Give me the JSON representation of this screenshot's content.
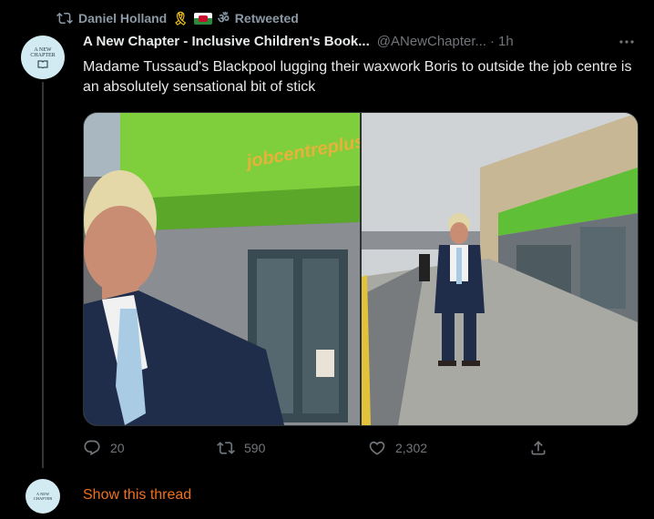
{
  "retweet": {
    "icon": "retweet-icon",
    "user_name": "Daniel Holland",
    "emoji_ribbon": "🎗",
    "flag_icon": "welsh-flag-icon",
    "emoji_om": "ॐ",
    "label": "Retweeted"
  },
  "tweet": {
    "avatar_text": "A NEW CHAPTER",
    "author_name": "A New Chapter - Inclusive Children's Book...",
    "handle": "@ANewChapter...",
    "separator": "·",
    "time": "1h",
    "more_icon": "more-icon",
    "text": "Madame Tussaud's Blackpool lugging their waxwork Boris to outside the job centre is an absolutely sensational bit of stick"
  },
  "media": {
    "images": [
      {
        "icon": "photo-waxwork-closeup-jobcentre"
      },
      {
        "icon": "photo-waxwork-street-jobcentre"
      }
    ],
    "sign_text": "jobcentreplus"
  },
  "actions": {
    "reply": {
      "icon": "reply-icon",
      "count": "20"
    },
    "retweet": {
      "icon": "retweet-icon",
      "count": "590"
    },
    "like": {
      "icon": "heart-icon",
      "count": "2,302"
    },
    "share": {
      "icon": "share-icon"
    }
  },
  "thread": {
    "avatar_text": "A NEW CHAPTER",
    "show_label": "Show this thread"
  },
  "colors": {
    "background": "#000000",
    "text_primary": "#e7e9ea",
    "text_secondary": "#71767b",
    "accent_link": "#f0701b",
    "border": "#2f3336"
  }
}
